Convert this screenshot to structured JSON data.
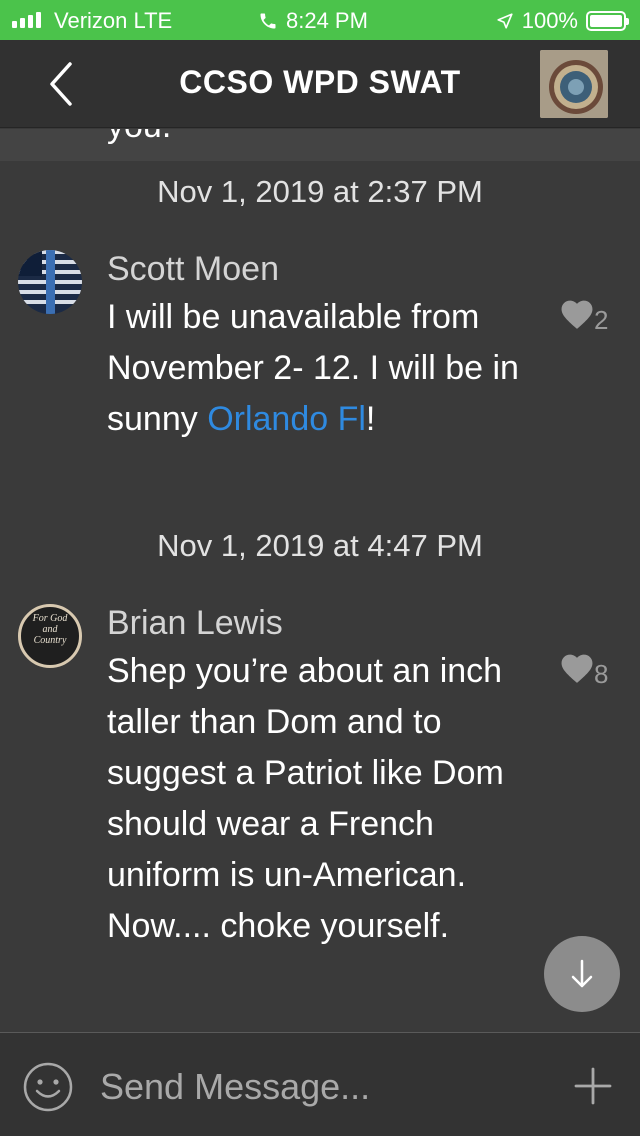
{
  "status_bar": {
    "carrier": "Verizon LTE",
    "time": "8:24 PM",
    "battery": "100%",
    "color": "#4bc34b"
  },
  "header": {
    "title": "CCSO WPD SWAT"
  },
  "previous_message_fragment": "you.",
  "messages": [
    {
      "timestamp": "Nov 1, 2019 at 2:37 PM",
      "sender": "Scott Moen",
      "text_before_link": "I will be unavailable from November 2- 12. I will be in sunny ",
      "link_text": "Orlando Fl",
      "text_after_link": "!",
      "likes": "2"
    },
    {
      "timestamp": "Nov 1, 2019 at 4:47 PM",
      "sender": "Brian Lewis",
      "avatar_text": [
        "For God",
        "and",
        "Country"
      ],
      "text": "Shep you’re about an inch taller than Dom and to suggest a Patriot like Dom should wear a French uniform is un-American. Now.... choke yourself.",
      "likes": "8"
    }
  ],
  "composer": {
    "placeholder": "Send Message..."
  },
  "colors": {
    "link": "#2f8ae0",
    "background": "#3a3a3a",
    "header": "#313131"
  }
}
